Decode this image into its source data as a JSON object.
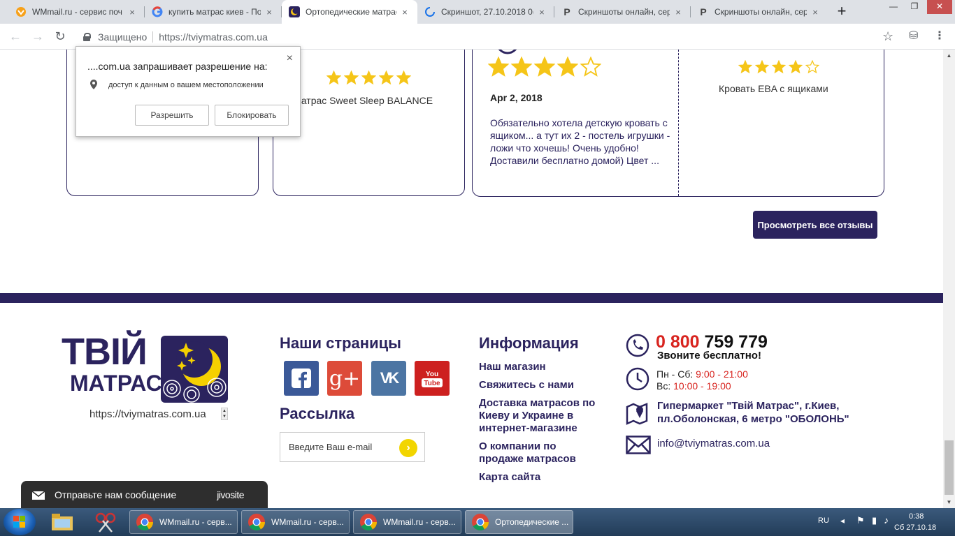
{
  "browser": {
    "tabs": [
      {
        "title": "WMmail.ru - сервис поч",
        "icon": "wmmail-icon"
      },
      {
        "title": "купить матрас киев - По",
        "icon": "google-icon"
      },
      {
        "title": "Ортопедические матрас",
        "icon": "tviymatras-icon"
      },
      {
        "title": "Скриншот, 27.10.2018 0(",
        "icon": "loading-icon"
      },
      {
        "title": "Скриншоты онлайн, сер",
        "icon": "p-icon"
      },
      {
        "title": "Скриншоты онлайн, сер",
        "icon": "p-icon"
      }
    ],
    "new_tab": "+",
    "secure_label": "Защищено",
    "url": "https://tviymatras.com.ua"
  },
  "permission_popup": {
    "title": "....com.ua запрашивает разрешение на:",
    "item": "доступ к данным о вашем местоположении",
    "allow": "Разрешить",
    "block": "Блокировать",
    "close": "×"
  },
  "reviews": {
    "cards": [
      {
        "product": "Матрас Sweet Sleep BALANCE",
        "rating": 5
      },
      {
        "date": "Apr 2, 2018",
        "rating": 4,
        "text": "Обязательно хотела детскую кровать с ящиком... а тут их 2 - постель игрушки - ложи что хочешь! Очень удобно! Доставили бесплатно домой) Цвет ..."
      },
      {
        "product": "Кровать EBA с ящиками",
        "rating": 4
      }
    ],
    "all_button": "Просмотреть все отзывы"
  },
  "footer": {
    "logo_line1": "ТВІЙ",
    "logo_line2": "МАТРАС",
    "site_select": "https://tviymatras.com.ua",
    "pages_heading": "Наши страницы",
    "newsletter_heading": "Рассылка",
    "email_placeholder": "Введите Ваш e-mail",
    "info_heading": "Информация",
    "info_links": [
      "Наш магазин",
      "Свяжитесь с нами",
      "Доставка матрасов по Киеву и Украине в интернет-магазине",
      "О компании по продаже матрасов",
      "Карта сайта"
    ],
    "social": [
      {
        "name": "facebook",
        "label": "f",
        "color": "#3b5998"
      },
      {
        "name": "google-plus",
        "label": "g+",
        "color": "#dd4b39"
      },
      {
        "name": "vk",
        "label": "VK",
        "color": "#4c75a3"
      },
      {
        "name": "youtube",
        "label": "You Tube",
        "color": "#cd201f"
      }
    ],
    "phone_prefix": "0 800",
    "phone_number": "759 779",
    "call_free": "Звоните бесплатно!",
    "hours_weekdays_label": "Пн - Сб:",
    "hours_weekdays": "9:00 - 21:00",
    "hours_sunday_label": "Вс:",
    "hours_sunday": "10:00 - 19:00",
    "address": "Гипермаркет \"Твій Матрас\", г.Киев, пл.Оболонская, 6 метро \"ОБОЛОНЬ\"",
    "email": "info@tviymatras.com.ua"
  },
  "chat": {
    "label": "Отправьте нам сообщение",
    "brand": "jivosite"
  },
  "taskbar": {
    "buttons": [
      "WMmail.ru - серв...",
      "WMmail.ru - серв...",
      "WMmail.ru - серв...",
      "Ортопедические ..."
    ],
    "lang": "RU",
    "time": "0:38",
    "date": "Сб 27.10.18"
  },
  "colors": {
    "brand": "#2b235e",
    "accent_red": "#d8241f",
    "star": "#f5c518"
  }
}
